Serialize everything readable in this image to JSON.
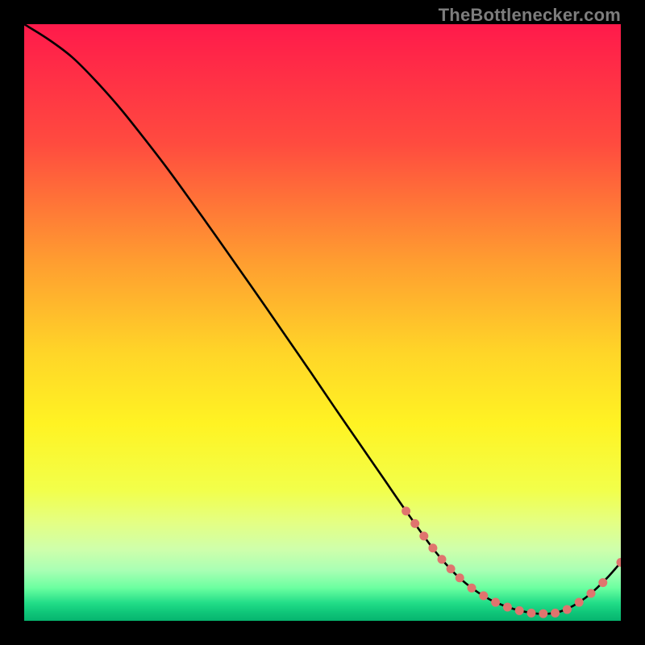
{
  "watermark": "TheBottlenecker.com",
  "colors": {
    "page_bg": "#000000",
    "curve": "#000000",
    "marker_fill": "#e0746e",
    "marker_stroke": "#e0746e",
    "gradient_stops": [
      {
        "offset": 0.0,
        "color": "#ff1a4b"
      },
      {
        "offset": 0.2,
        "color": "#ff4b3f"
      },
      {
        "offset": 0.4,
        "color": "#ff9e30"
      },
      {
        "offset": 0.55,
        "color": "#ffd528"
      },
      {
        "offset": 0.67,
        "color": "#fff323"
      },
      {
        "offset": 0.78,
        "color": "#f2ff4a"
      },
      {
        "offset": 0.835,
        "color": "#e4ff83"
      },
      {
        "offset": 0.88,
        "color": "#cfffab"
      },
      {
        "offset": 0.915,
        "color": "#a9ffb4"
      },
      {
        "offset": 0.945,
        "color": "#6bffa0"
      },
      {
        "offset": 0.97,
        "color": "#22dd88"
      },
      {
        "offset": 0.985,
        "color": "#10c77a"
      },
      {
        "offset": 1.0,
        "color": "#06b46e"
      }
    ]
  },
  "chart_data": {
    "type": "line",
    "title": "",
    "xlabel": "",
    "ylabel": "",
    "xlim": [
      0,
      100
    ],
    "ylim": [
      0,
      100
    ],
    "series": [
      {
        "name": "bottleneck-curve",
        "x": [
          0,
          4,
          8,
          12,
          16,
          20,
          24,
          28,
          32,
          36,
          40,
          44,
          48,
          52,
          56,
          60,
          64,
          68,
          70,
          72,
          74,
          76,
          78,
          80,
          82,
          84,
          86,
          88,
          90,
          92,
          94,
          96,
          98,
          100
        ],
        "y": [
          100,
          97.5,
          94.5,
          90.5,
          86,
          81,
          75.8,
          70.3,
          64.7,
          59,
          53.3,
          47.5,
          41.7,
          35.8,
          30,
          24.2,
          18.4,
          12.8,
          10.3,
          8.1,
          6.3,
          4.8,
          3.6,
          2.7,
          2.0,
          1.5,
          1.2,
          1.2,
          1.6,
          2.5,
          3.8,
          5.5,
          7.5,
          9.8
        ]
      }
    ],
    "markers": {
      "name": "highlight-points",
      "x": [
        64.0,
        65.5,
        67.0,
        68.5,
        70.0,
        71.5,
        73.0,
        75.0,
        77.0,
        79.0,
        81.0,
        83.0,
        85.0,
        87.0,
        89.0,
        91.0,
        93.0,
        95.0,
        97.0,
        100.0
      ],
      "y": [
        18.4,
        16.3,
        14.2,
        12.2,
        10.3,
        8.7,
        7.2,
        5.5,
        4.2,
        3.1,
        2.3,
        1.7,
        1.3,
        1.2,
        1.3,
        1.9,
        3.1,
        4.6,
        6.4,
        9.8
      ]
    }
  }
}
